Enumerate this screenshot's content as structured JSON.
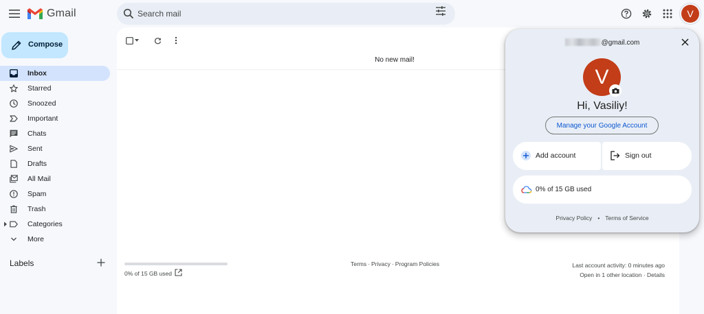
{
  "header": {
    "app_name": "Gmail",
    "search_placeholder": "Search mail",
    "avatar_initial": "V",
    "icons": [
      "menu-icon",
      "gmail-logo",
      "search-icon",
      "tune-icon",
      "help-icon",
      "gear-icon",
      "apps-icon"
    ],
    "colors": {
      "gmail_red": "#ea4335",
      "gmail_blue": "#4285f4",
      "gmail_green": "#34a853",
      "gmail_yellow": "#fbbc04",
      "avatar": "#c23d18"
    }
  },
  "sidebar": {
    "compose_label": "Compose",
    "items": [
      {
        "label": "Inbox",
        "icon": "inbox-icon",
        "active": true
      },
      {
        "label": "Starred",
        "icon": "star-icon"
      },
      {
        "label": "Snoozed",
        "icon": "clock-icon"
      },
      {
        "label": "Important",
        "icon": "important-icon"
      },
      {
        "label": "Chats",
        "icon": "chat-icon"
      },
      {
        "label": "Sent",
        "icon": "send-icon"
      },
      {
        "label": "Drafts",
        "icon": "draft-icon"
      },
      {
        "label": "All Mail",
        "icon": "all-mail-icon"
      },
      {
        "label": "Spam",
        "icon": "spam-icon"
      },
      {
        "label": "Trash",
        "icon": "trash-icon"
      },
      {
        "label": "Categories",
        "icon": "label-icon"
      },
      {
        "label": "More",
        "icon": "chevron-down-icon"
      }
    ],
    "labels_title": "Labels"
  },
  "main": {
    "empty_text": "No new mail!",
    "storage_text": "0% of 15 GB used",
    "storage_fraction": 0,
    "footer_links": [
      "Terms",
      "Privacy",
      "Program Policies"
    ],
    "activity_line": "Last account activity: 0 minutes ago",
    "open_in_text": "Open in 1 other location",
    "details_text": "Details"
  },
  "account_popup": {
    "email_suffix": "@gmail.com",
    "avatar_initial": "V",
    "greeting": "Hi, Vasiliy!",
    "manage_label": "Manage your Google Account",
    "add_account_label": "Add account",
    "sign_out_label": "Sign out",
    "storage_label": "0% of 15 GB used",
    "privacy_label": "Privacy Policy",
    "terms_label": "Terms of Service"
  }
}
